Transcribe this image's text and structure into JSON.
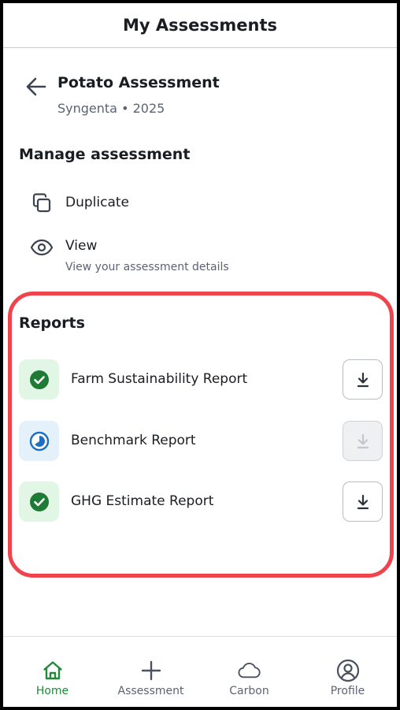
{
  "header": {
    "title": "My Assessments"
  },
  "assessment": {
    "name": "Potato Assessment",
    "subtitle": "Syngenta • 2025"
  },
  "manage": {
    "title": "Manage assessment",
    "duplicate_label": "Duplicate",
    "view_label": "View",
    "view_sub": "View your assessment details"
  },
  "reports": {
    "title": "Reports",
    "items": [
      {
        "label": "Farm Sustainability Report",
        "status": "complete",
        "download_enabled": true
      },
      {
        "label": "Benchmark Report",
        "status": "in-progress",
        "download_enabled": false
      },
      {
        "label": "GHG Estimate Report",
        "status": "complete",
        "download_enabled": true
      }
    ]
  },
  "nav": {
    "items": [
      {
        "label": "Home",
        "icon": "home-icon",
        "active": true
      },
      {
        "label": "Assessment",
        "icon": "plus-icon",
        "active": false
      },
      {
        "label": "Carbon",
        "icon": "cloud-icon",
        "active": false
      },
      {
        "label": "Profile",
        "icon": "profile-icon",
        "active": false
      }
    ]
  },
  "colors": {
    "accent_green": "#1e8a3a",
    "highlight_red": "#f0434c",
    "progress_blue": "#1f6fc0"
  }
}
